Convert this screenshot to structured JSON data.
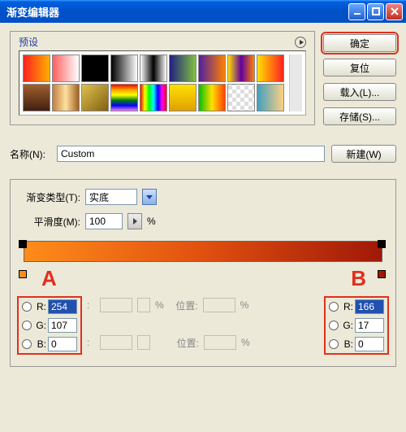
{
  "window": {
    "title": "渐变编辑器"
  },
  "buttons": {
    "ok": "确定",
    "reset": "复位",
    "load": "载入(L)...",
    "save": "存储(S)...",
    "new": "新建(W)"
  },
  "preset": {
    "label": "预设"
  },
  "name": {
    "label": "名称(N):",
    "value": "Custom"
  },
  "gradtype": {
    "label": "渐变类型(T):",
    "value": "实底"
  },
  "smooth": {
    "label": "平滑度(M):",
    "value": "100",
    "unit": "%"
  },
  "pos": {
    "label": "位置:",
    "unit": "%"
  },
  "annotations": {
    "A": "A",
    "B": "B"
  },
  "rgbA": {
    "R": "254",
    "G": "107",
    "B": "0"
  },
  "rgbB": {
    "R": "166",
    "G": "17",
    "B": "0"
  },
  "labels": {
    "R": "R:",
    "G": "G:",
    "B": "B:"
  },
  "chart_data": {
    "type": "gradient",
    "stops": [
      {
        "position": 0,
        "r": 254,
        "g": 107,
        "b": 0,
        "label": "A"
      },
      {
        "position": 100,
        "r": 166,
        "g": 17,
        "b": 0,
        "label": "B"
      }
    ]
  }
}
